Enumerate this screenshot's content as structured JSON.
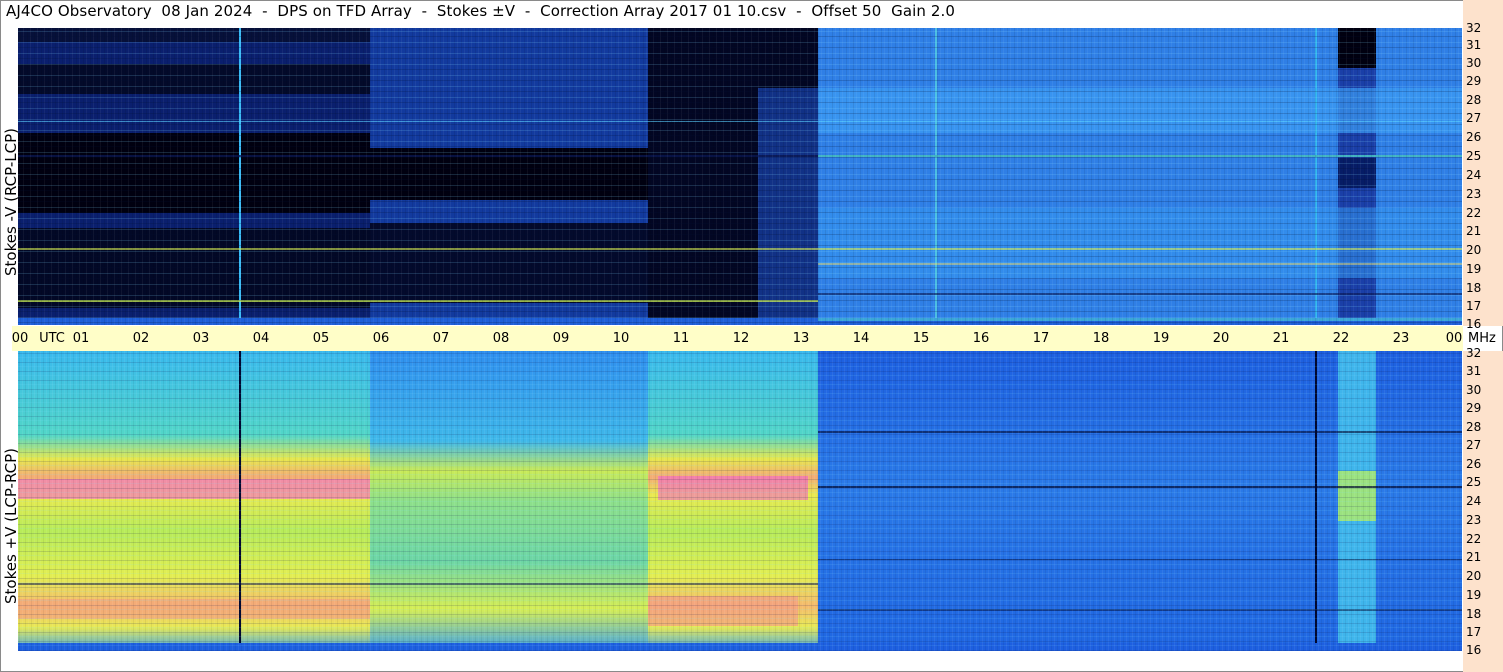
{
  "title": "AJ4CO Observatory  08 Jan 2024  -  DPS on TFD Array  -  Stokes ±V  -  Correction Array 2017 01 10.csv  -  Offset 50  Gain 2.0",
  "top_panel": {
    "ylabel": "Stokes -V (RCP-LCP)"
  },
  "bottom_panel": {
    "ylabel": "Stokes +V (LCP-RCP)"
  },
  "time_axis": {
    "labels": [
      "00",
      "UTC",
      "01",
      "02",
      "03",
      "04",
      "05",
      "06",
      "07",
      "08",
      "09",
      "10",
      "11",
      "12",
      "13",
      "14",
      "15",
      "16",
      "17",
      "18",
      "19",
      "20",
      "21",
      "22",
      "23",
      "00",
      "MHz"
    ]
  },
  "freq_axis": {
    "labels": [
      "32",
      "31",
      "30",
      "29",
      "28",
      "27",
      "26",
      "25",
      "24",
      "23",
      "22",
      "21",
      "20",
      "19",
      "18",
      "17",
      "16"
    ],
    "range_mhz": [
      16,
      32
    ]
  },
  "colors": {
    "black": "#000010",
    "dark_blue": "#0a1f6e",
    "blue": "#1d5fe0",
    "sky": "#2f8bf0",
    "cyan": "#39b6f0",
    "aqua": "#46d2d8",
    "yellow": "#e9ee52",
    "orange": "#f6b870",
    "pink": "#f05bd6",
    "time_bar": "#fffec8",
    "freq_bar": "#fde2cc"
  }
}
